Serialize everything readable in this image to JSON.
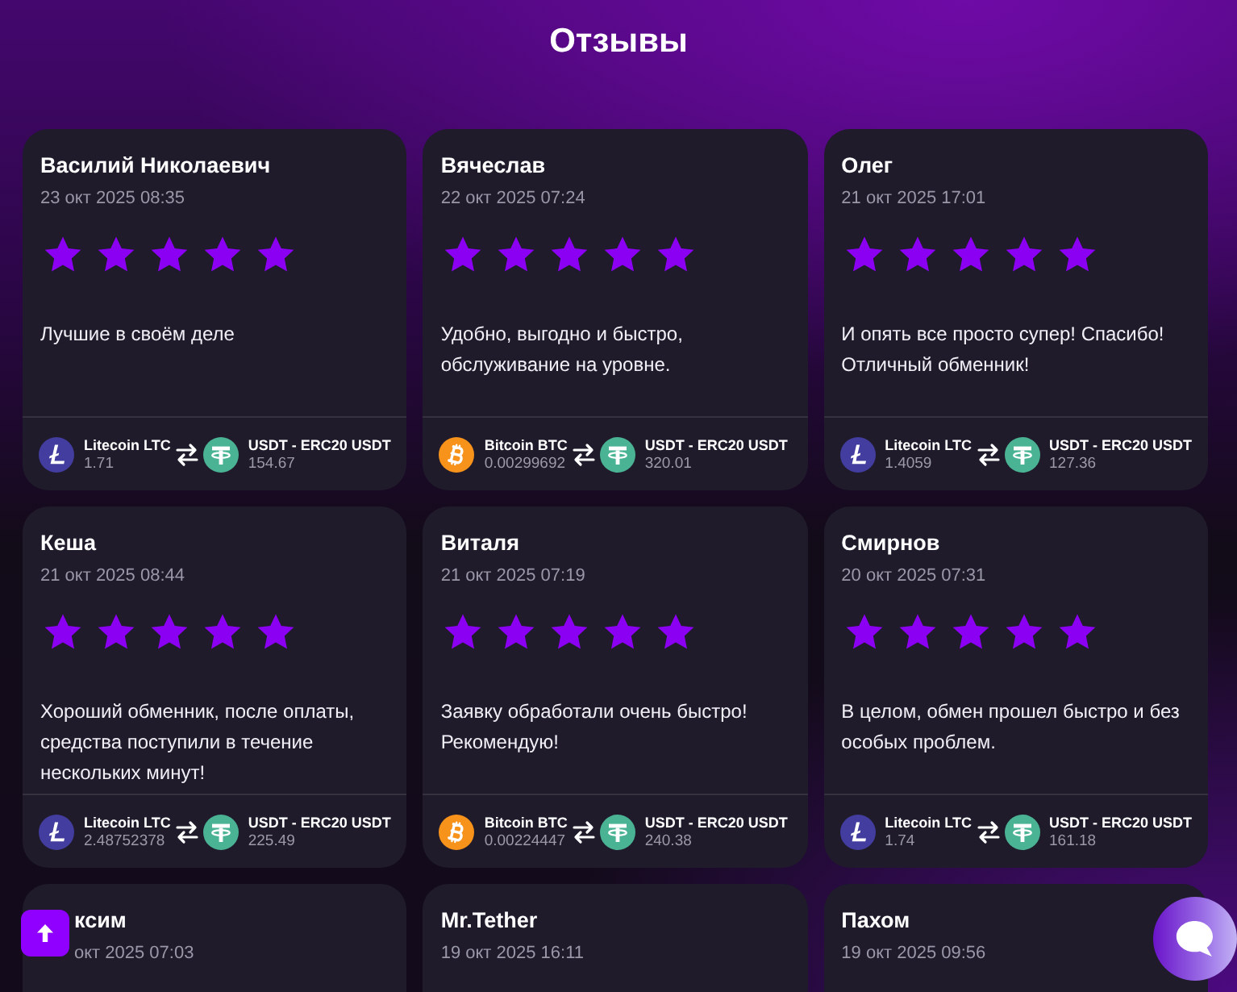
{
  "page": {
    "title": "Отзывы"
  },
  "reviews": [
    {
      "name": "Василий Николаевич",
      "date": "23 окт 2025 08:35",
      "stars": 5,
      "text": "Лучшие в своём деле",
      "from": {
        "kind": "litecoin",
        "coin": "Litecoin LTC",
        "amount": "1.71"
      },
      "to": {
        "kind": "tether",
        "coin": "USDT - ERC20 USDT",
        "amount": "154.67"
      }
    },
    {
      "name": "Вячеслав",
      "date": "22 окт 2025 07:24",
      "stars": 5,
      "text": "Удобно, выгодно и быстро, обслуживание на уровне.",
      "from": {
        "kind": "bitcoin",
        "coin": "Bitcoin BTC",
        "amount": "0.00299692"
      },
      "to": {
        "kind": "tether",
        "coin": "USDT - ERC20 USDT",
        "amount": "320.01"
      }
    },
    {
      "name": "Олег",
      "date": "21 окт 2025 17:01",
      "stars": 5,
      "text": "И опять все просто супер! Спасибо! Отличный обменник!",
      "from": {
        "kind": "litecoin",
        "coin": "Litecoin LTC",
        "amount": "1.4059"
      },
      "to": {
        "kind": "tether",
        "coin": "USDT - ERC20 USDT",
        "amount": "127.36"
      }
    },
    {
      "name": "Кеша",
      "date": "21 окт 2025 08:44",
      "stars": 5,
      "text": "Хороший обменник, после оплаты, средства поступили в течение нескольких минут!",
      "from": {
        "kind": "litecoin",
        "coin": "Litecoin LTC",
        "amount": "2.48752378"
      },
      "to": {
        "kind": "tether",
        "coin": "USDT - ERC20 USDT",
        "amount": "225.49"
      }
    },
    {
      "name": "Виталя",
      "date": "21 окт 2025 07:19",
      "stars": 5,
      "text": "Заявку обработали очень быстро! Рекомендую!",
      "from": {
        "kind": "bitcoin",
        "coin": "Bitcoin BTC",
        "amount": "0.00224447"
      },
      "to": {
        "kind": "tether",
        "coin": "USDT - ERC20 USDT",
        "amount": "240.38"
      }
    },
    {
      "name": "Смирнов",
      "date": "20 окт 2025 07:31",
      "stars": 5,
      "text": "В целом, обмен прошел быстро и без особых проблем.",
      "from": {
        "kind": "litecoin",
        "coin": "Litecoin LTC",
        "amount": "1.74"
      },
      "to": {
        "kind": "tether",
        "coin": "USDT - ERC20 USDT",
        "amount": "161.18"
      }
    },
    {
      "name": "ксим",
      "date": "окт 2025 07:03"
    },
    {
      "name": "Mr.Tether",
      "date": "19 окт 2025 16:11"
    },
    {
      "name": "Пахом",
      "date": "19 окт 2025 09:56"
    }
  ]
}
